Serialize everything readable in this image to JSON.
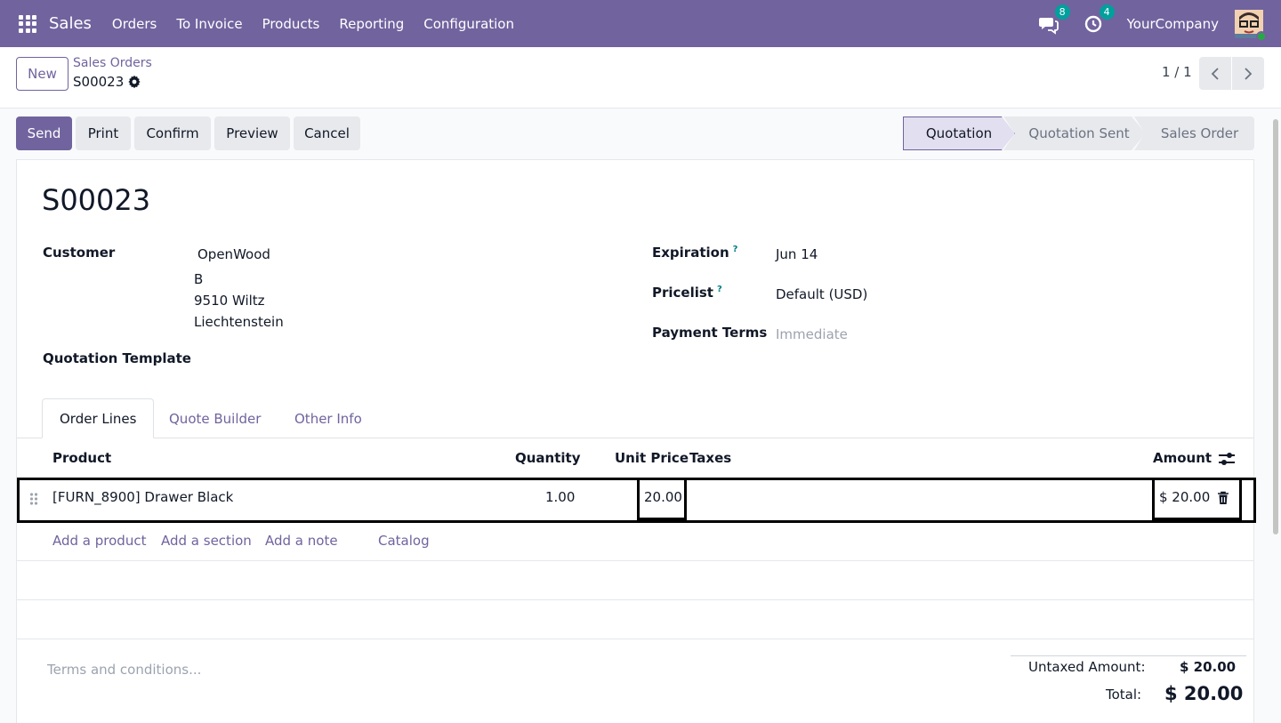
{
  "navbar": {
    "brand": "Sales",
    "menu": [
      "Orders",
      "To Invoice",
      "Products",
      "Reporting",
      "Configuration"
    ],
    "messages_count": "8",
    "activities_count": "4",
    "company": "YourCompany"
  },
  "control": {
    "new_label": "New",
    "breadcrumb": "Sales Orders",
    "record": "S00023",
    "pager": "1 / 1"
  },
  "actions": {
    "send": "Send",
    "print": "Print",
    "confirm": "Confirm",
    "preview": "Preview",
    "cancel": "Cancel"
  },
  "statusbar": [
    "Quotation",
    "Quotation Sent",
    "Sales Order"
  ],
  "form": {
    "title": "S00023",
    "customer_label": "Customer",
    "customer_name": "OpenWood",
    "customer_address": [
      "B",
      "9510 Wiltz",
      "Liechtenstein"
    ],
    "quotation_template_label": "Quotation Template",
    "expiration_label": "Expiration",
    "expiration_value": "Jun 14",
    "pricelist_label": "Pricelist",
    "pricelist_value": "Default (USD)",
    "payment_terms_label": "Payment Terms",
    "payment_terms_placeholder": "Immediate",
    "help_mark": "?"
  },
  "tabs": [
    "Order Lines",
    "Quote Builder",
    "Other Info"
  ],
  "order_lines": {
    "columns": {
      "product": "Product",
      "quantity": "Quantity",
      "unit_price": "Unit Price",
      "taxes": "Taxes",
      "amount": "Amount"
    },
    "rows": [
      {
        "product": "[FURN_8900] Drawer Black",
        "quantity": "1.00",
        "unit_price": "20.00",
        "taxes": "",
        "amount": "$ 20.00"
      }
    ],
    "add_links": [
      "Add a product",
      "Add a section",
      "Add a note",
      "Catalog"
    ]
  },
  "footer": {
    "terms_placeholder": "Terms and conditions...",
    "untaxed_label": "Untaxed Amount:",
    "untaxed_value": "$ 20.00",
    "total_label": "Total:",
    "total_value": "$ 20.00"
  },
  "colors": {
    "brand": "#71639e",
    "badge": "#00a09d"
  }
}
